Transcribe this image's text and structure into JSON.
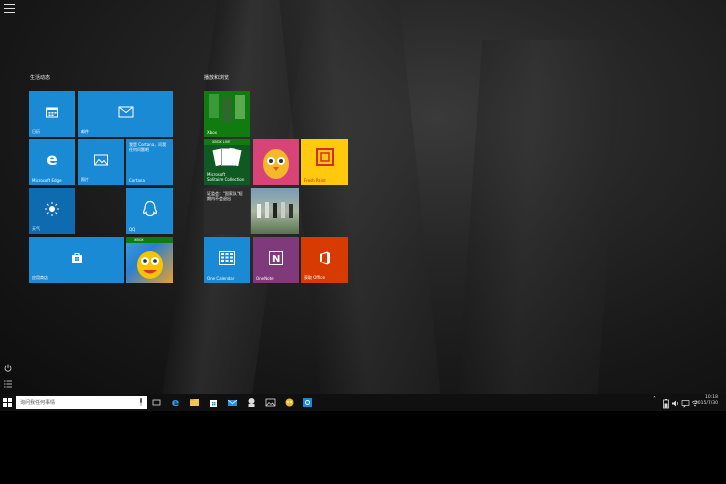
{
  "start": {
    "group1_title": "生活动态",
    "group2_title": "播放和浏览",
    "tiles1": {
      "calendar": "日历",
      "mail": "邮件",
      "edge": "Microsoft Edge",
      "photos": "照片",
      "cortana_line1": "我是 Cortana，问我",
      "cortana_line2": "任何问题吧",
      "cortana": "Cortana",
      "weather": "天气",
      "qq": "QQ",
      "store": "应用商店",
      "xbox_game_badge": "XBOX"
    },
    "tiles2": {
      "xbox": "Xbox",
      "xbox_live": "XBOX LIVE",
      "solitaire_line1": "Microsoft",
      "solitaire_line2": "Solitaire Collection",
      "freshpaint": "Fresh Paint",
      "news_line1": "证监会：\"国家队\"短",
      "news_line2": "期内不会退出",
      "onecalendar": "One Calendar",
      "onenote": "OneNote",
      "office": "获取 Office"
    }
  },
  "taskbar": {
    "search_placeholder": "询问我任何事情",
    "clock_time": "10:18",
    "clock_date": "2015/7/30"
  },
  "colors": {
    "tile_blue": "#1a8ad4",
    "tile_blue_dark": "#0f6bb0",
    "xbox_green": "#107c10",
    "onenote_purple": "#80397b",
    "office_orange": "#d83b01",
    "freshpaint_yellow": "#ffc90e"
  }
}
